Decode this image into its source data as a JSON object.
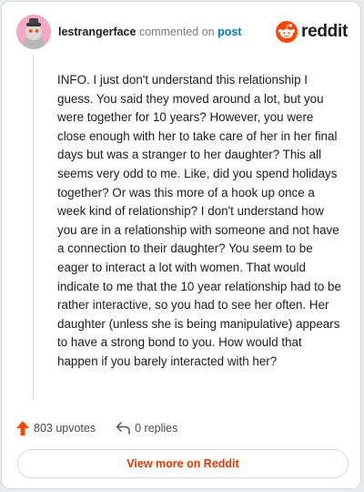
{
  "header": {
    "username": "lestrangerface",
    "action_text": "commented on",
    "post_link": "post",
    "brand": "reddit"
  },
  "comment": {
    "body": "INFO. I just don't understand this relationship I guess. You said they moved around a lot, but you were together for 10 years? However, you were close enough with her to take care of her in her final days but was a stranger to her daughter? This all seems very odd to me. Like, did you spend holidays together? Or was this more of a hook up once a week kind of relationship? I don't understand how you are in a relationship with someone and not have a connection to their daughter? You seem to be eager to interact a lot with women. That would indicate to me that the 10 year relationship had to be rather interactive, so you had to see her often. Her daughter (unless she is being manipulative) appears to have a strong bond to you. How would that happen if you barely interacted with her?"
  },
  "footer": {
    "upvotes": "803 upvotes",
    "replies": "0 replies"
  },
  "view_more": "View more on Reddit",
  "icons": {
    "avatar": "avatar-icon",
    "brand_logo": "reddit-logo-icon",
    "upvote": "upvote-arrow-icon",
    "reply": "reply-arrow-icon"
  },
  "colors": {
    "brand_orange": "#ff4500",
    "upvote_orange": "#ff4500",
    "link_blue": "#0079d3",
    "button_text": "#d93a00",
    "avatar_pink": "#f3a8c6"
  }
}
